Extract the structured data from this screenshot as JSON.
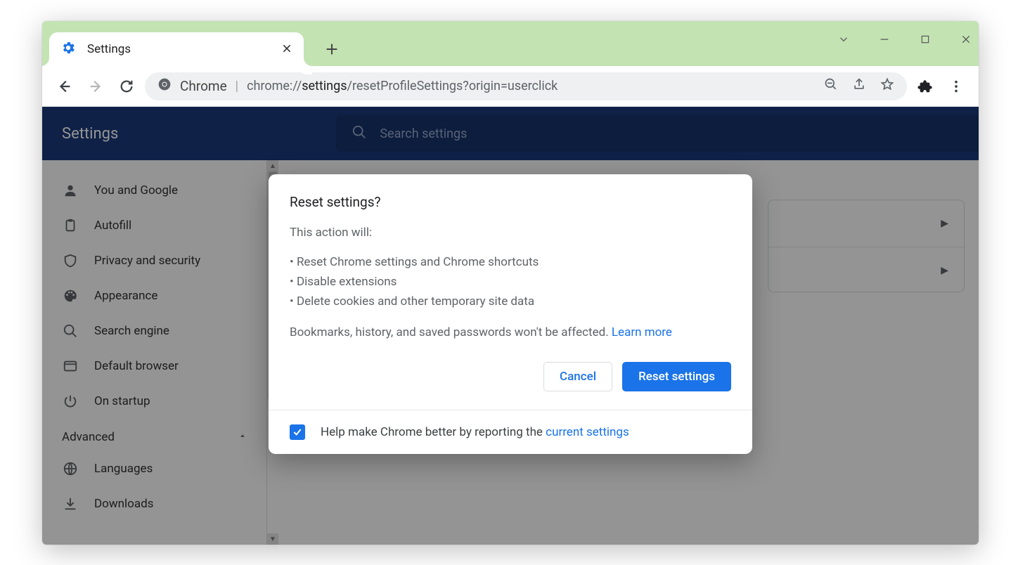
{
  "window": {
    "tab_title": "Settings",
    "url_origin_label": "Chrome",
    "url_pre_strong": "chrome://",
    "url_strong": "settings",
    "url_post_strong": "/resetProfileSettings?origin=userclick"
  },
  "settings_header": {
    "title": "Settings",
    "search_placeholder": "Search settings"
  },
  "sidebar": {
    "items": [
      {
        "icon": "person-icon",
        "label": "You and Google"
      },
      {
        "icon": "clipboard-icon",
        "label": "Autofill"
      },
      {
        "icon": "shield-icon",
        "label": "Privacy and security"
      },
      {
        "icon": "palette-icon",
        "label": "Appearance"
      },
      {
        "icon": "search-icon",
        "label": "Search engine"
      },
      {
        "icon": "browser-icon",
        "label": "Default browser"
      },
      {
        "icon": "power-icon",
        "label": "On startup"
      }
    ],
    "advanced_label": "Advanced",
    "advanced_items": [
      {
        "icon": "globe-icon",
        "label": "Languages"
      },
      {
        "icon": "download-icon",
        "label": "Downloads"
      }
    ]
  },
  "dialog": {
    "title": "Reset settings?",
    "intro": "This action will:",
    "bullets": [
      "Reset Chrome settings and Chrome shortcuts",
      "Disable extensions",
      "Delete cookies and other temporary site data"
    ],
    "footnote_pre": "Bookmarks, history, and saved passwords won't be affected. ",
    "learn_more": "Learn more",
    "cancel": "Cancel",
    "confirm": "Reset settings",
    "report_pre": "Help make Chrome better by reporting the ",
    "report_link": "current settings",
    "report_checked": true
  }
}
